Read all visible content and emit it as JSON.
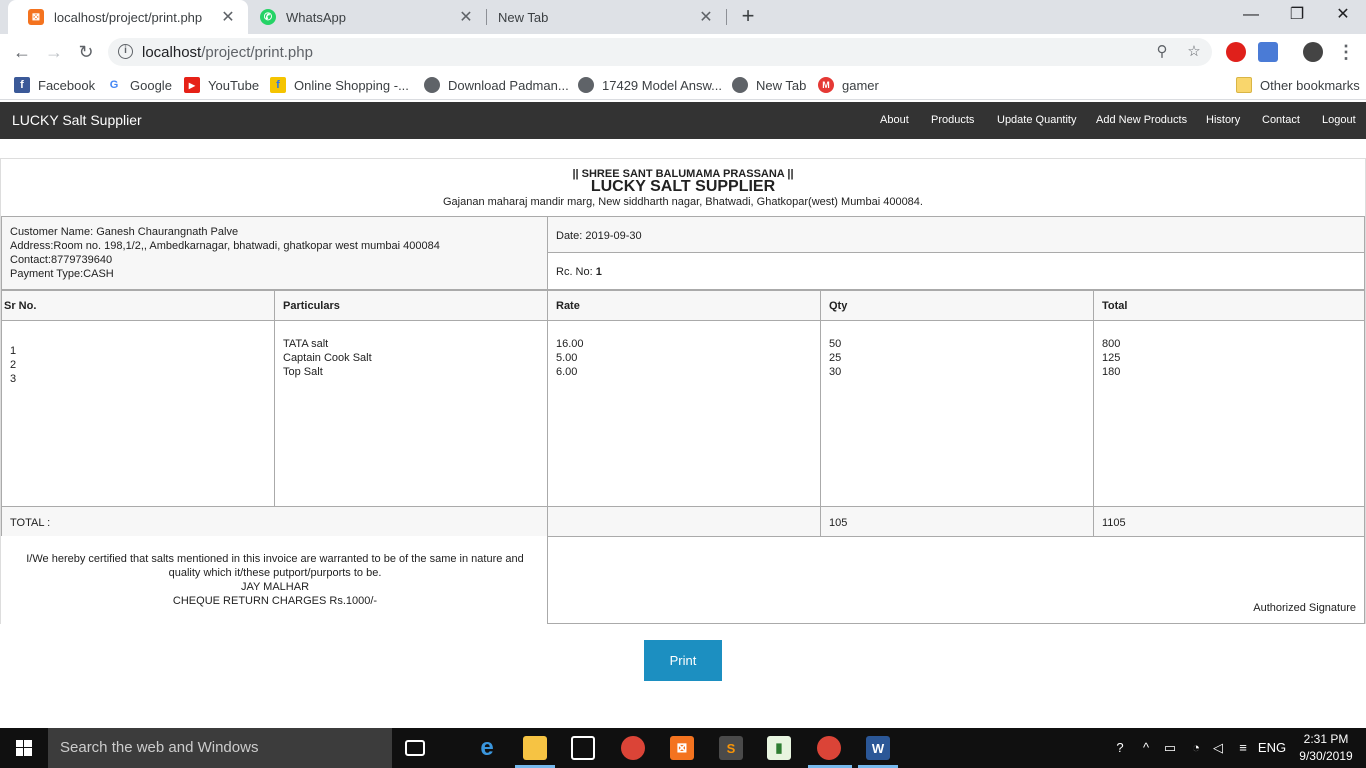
{
  "browser": {
    "tabs": [
      {
        "title": "localhost/project/print.php",
        "icon": "xampp-icon",
        "active": true
      },
      {
        "title": "WhatsApp",
        "icon": "whatsapp-icon",
        "active": false
      },
      {
        "title": "New Tab",
        "icon": "",
        "active": false
      }
    ],
    "new_tab": "+",
    "address": {
      "host": "localhost",
      "path": "/project/print.php"
    },
    "bookmarks": [
      "Facebook",
      "Google",
      "YouTube",
      "Online Shopping -...",
      "Download Padman...",
      "17429 Model Answ...",
      "New Tab",
      "gamer"
    ],
    "other_bookmarks": "Other bookmarks"
  },
  "site": {
    "brand": "LUCKY Salt Supplier",
    "nav": [
      "About",
      "Products",
      "Update Quantity",
      "Add New Products",
      "History",
      "Contact",
      "Logout"
    ]
  },
  "invoice": {
    "header_line1": "|| SHREE SANT BALUMAMA PRASSANA ||",
    "company": "LUCKY SALT SUPPLIER",
    "company_address": "Gajanan maharaj mandir marg, New siddharth nagar, Bhatwadi, Ghatkopar(west) Mumbai 400084.",
    "customer_name": "Customer Name: Ganesh Chaurangnath Palve",
    "customer_address": "Address:Room no. 198,1/2,, Ambedkarnagar, bhatwadi, ghatkopar west mumbai 400084",
    "contact": "Contact:8779739640",
    "payment_type": "Payment Type:CASH",
    "date": "Date: 2019-09-30",
    "receipt_label": "Rc. No: ",
    "receipt_no": "1",
    "columns": [
      "Sr No.",
      "Particulars",
      "Rate",
      "Qty",
      "Total"
    ],
    "items": [
      {
        "sr": "1",
        "particular": "TATA salt",
        "rate": "16.00",
        "qty": "50",
        "total": "800"
      },
      {
        "sr": "2",
        "particular": "Captain Cook Salt",
        "rate": "5.00",
        "qty": "25",
        "total": "125"
      },
      {
        "sr": "3",
        "particular": "Top Salt",
        "rate": "6.00",
        "qty": "30",
        "total": "180"
      }
    ],
    "total_label": "TOTAL :",
    "total_qty": "105",
    "total_amount": "1105",
    "certification": "I/We hereby certified that salts mentioned in this invoice are warranted to be of the same in nature and quality which it/these putport/purports to be.",
    "motto": "JAY MALHAR",
    "cheque_note": "CHEQUE RETURN CHARGES Rs.1000/-",
    "signature": "Authorized Signature"
  },
  "print_button": "Print",
  "taskbar": {
    "search_placeholder": "Search the web and Windows",
    "language": "ENG",
    "time": "2:31 PM",
    "date": "9/30/2019"
  },
  "colors": {
    "navbar": "#333333",
    "print_button": "#1c8fc1",
    "taskbar": "#101010"
  }
}
